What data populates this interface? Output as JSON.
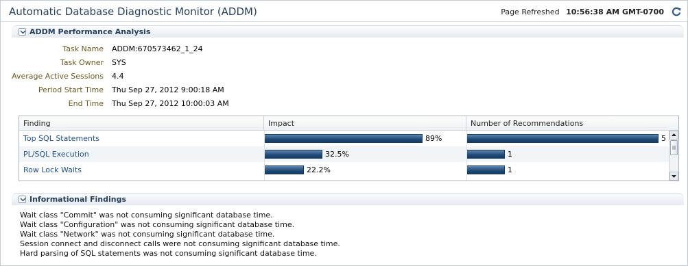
{
  "header": {
    "title": "Automatic Database Diagnostic Monitor (ADDM)",
    "refresh_label": "Page Refreshed",
    "refresh_time": "10:56:38 AM GMT-0700",
    "refresh_icon": "refresh-icon"
  },
  "performance": {
    "title": "ADDM Performance Analysis",
    "fields": [
      {
        "label": "Task Name",
        "value": "ADDM:670573462_1_24"
      },
      {
        "label": "Task Owner",
        "value": "SYS"
      },
      {
        "label": "Average Active Sessions",
        "value": "4.4"
      },
      {
        "label": "Period Start Time",
        "value": "Thu Sep 27, 2012 9:00:18 AM"
      },
      {
        "label": "End Time",
        "value": "Thu Sep 27, 2012 10:00:03 AM"
      }
    ],
    "table": {
      "columns": [
        "Finding",
        "Impact",
        "Number of Recommendations"
      ],
      "rows": [
        {
          "finding": "Top SQL Statements",
          "impact_pct": 89,
          "impact_label": "89%",
          "recs": 5,
          "recs_label": "5"
        },
        {
          "finding": "PL/SQL Execution",
          "impact_pct": 32.5,
          "impact_label": "32.5%",
          "recs": 1,
          "recs_label": "1"
        },
        {
          "finding": "Row Lock Waits",
          "impact_pct": 22.2,
          "impact_label": "22.2%",
          "recs": 1,
          "recs_label": "1"
        }
      ],
      "max_recs": 5
    }
  },
  "informational": {
    "title": "Informational Findings",
    "lines": [
      "Wait class \"Commit\" was not consuming significant database time.",
      "Wait class \"Configuration\" was not consuming significant database time.",
      "Wait class \"Network\" was not consuming significant database time.",
      "Session connect and disconnect calls were not consuming significant database time.",
      "Hard parsing of SQL statements was not consuming significant database time."
    ]
  },
  "colors": {
    "title": "#25405e",
    "label": "#6b5a1e",
    "link": "#1f4f8c",
    "bar": "#1f4a77"
  }
}
